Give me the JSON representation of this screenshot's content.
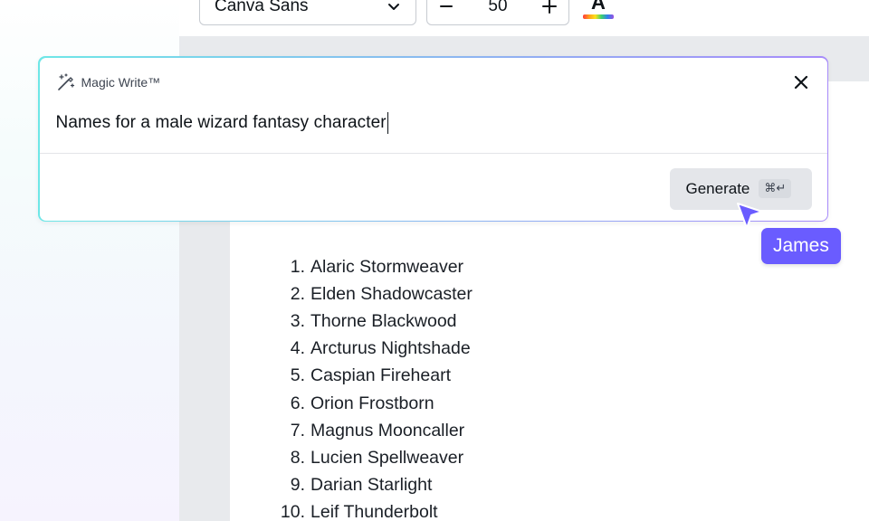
{
  "toolbar": {
    "font_family_value": "Canva Sans",
    "font_size_value": "50",
    "decrease_symbol": "−",
    "increase_symbol": "+",
    "text_color_letter": "A"
  },
  "magic_write": {
    "title": "Magic Write™",
    "prompt_text": "Names for a male wizard fantasy character",
    "generate_label": "Generate",
    "generate_shortcut": "⌘↵",
    "close_symbol": "×"
  },
  "collaborator": {
    "name": "James",
    "color": "#6a5cff"
  },
  "names": [
    {
      "num": "1.",
      "name": "Alaric Stormweaver"
    },
    {
      "num": "2.",
      "name": "Elden Shadowcaster"
    },
    {
      "num": "3.",
      "name": "Thorne Blackwood"
    },
    {
      "num": "4.",
      "name": "Arcturus Nightshade"
    },
    {
      "num": "5.",
      "name": "Caspian Fireheart"
    },
    {
      "num": "6.",
      "name": "Orion Frostborn"
    },
    {
      "num": "7.",
      "name": "Magnus Mooncaller"
    },
    {
      "num": "8.",
      "name": "Lucien Spellweaver"
    },
    {
      "num": "9.",
      "name": "Darian Starlight"
    },
    {
      "num": "10.",
      "name": "Leif Thunderbolt"
    }
  ],
  "icons": {
    "magic_write": "magic-wand-icon",
    "close": "close-icon",
    "dropdown": "chevron-down-icon",
    "cursor": "cursor-arrow-icon"
  }
}
